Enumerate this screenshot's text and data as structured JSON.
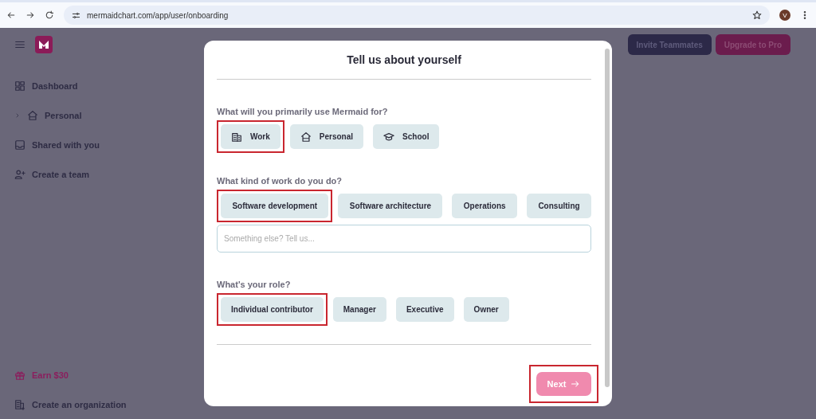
{
  "browser": {
    "url": "mermaidchart.com/app/user/onboarding",
    "profile_initial": "V"
  },
  "sidebar": {
    "items": [
      {
        "label": "Dashboard"
      },
      {
        "label": "Personal",
        "expanded": false
      },
      {
        "label": "Shared with you"
      },
      {
        "label": "Create a team"
      }
    ],
    "footer": [
      {
        "label": "Earn $30",
        "kind": "promo"
      },
      {
        "label": "Create an organization",
        "kind": "nav"
      }
    ]
  },
  "header_buttons": [
    {
      "label": "Invite Teammates",
      "kind": "secondary"
    },
    {
      "label": "Upgrade to Pro",
      "kind": "primary"
    }
  ],
  "dialog": {
    "title": "Tell us about yourself",
    "questions": [
      {
        "label": "What will you primarily use Mermaid for?",
        "options": [
          {
            "label": "Work",
            "selected": true
          },
          {
            "label": "Personal",
            "selected": false
          },
          {
            "label": "School",
            "selected": false
          }
        ]
      },
      {
        "label": "What kind of work do you do?",
        "options": [
          {
            "label": "Software development",
            "selected": true
          },
          {
            "label": "Software architecture",
            "selected": false
          },
          {
            "label": "Operations",
            "selected": false
          },
          {
            "label": "Consulting",
            "selected": false
          }
        ],
        "input": {
          "placeholder": "Something else? Tell us..."
        }
      },
      {
        "label": "What's your role?",
        "options": [
          {
            "label": "Individual contributor",
            "selected": true
          },
          {
            "label": "Manager",
            "selected": false
          },
          {
            "label": "Executive",
            "selected": false
          },
          {
            "label": "Owner",
            "selected": false
          }
        ]
      }
    ],
    "next_button": {
      "label": "Next",
      "highlighted": true
    }
  }
}
